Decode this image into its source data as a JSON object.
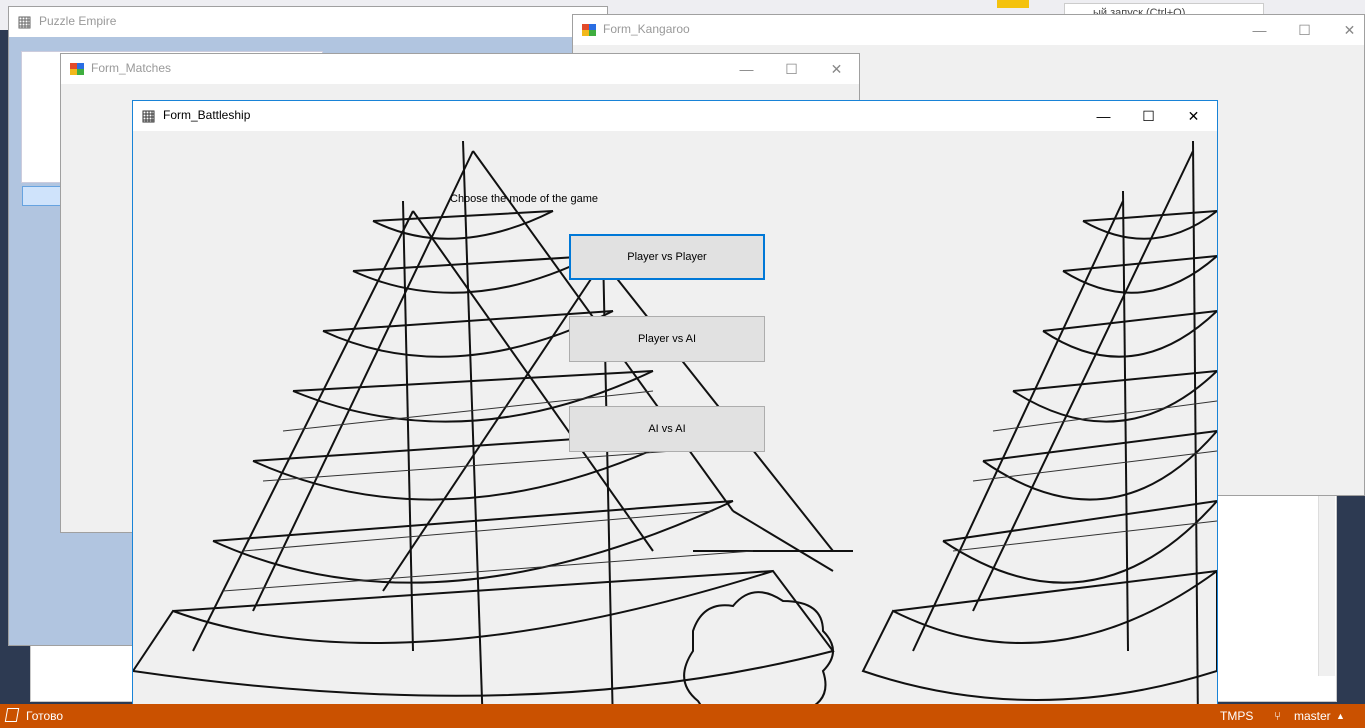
{
  "vs": {
    "quick_launch": "ый запуск (Ctrl+Q)",
    "status_ready": "Готово",
    "status_tmps": "TMPS",
    "branch": "master",
    "accent": "#ca5100"
  },
  "windows": {
    "puzzle_empire": {
      "title": "Puzzle Empire"
    },
    "kangaroo": {
      "title": "Form_Kangaroo"
    },
    "matches": {
      "title": "Form_Matches"
    },
    "battleship": {
      "title": "Form_Battleship",
      "prompt": "Choose the mode of the game",
      "buttons": {
        "pvp": "Player vs Player",
        "pvai": "Player vs AI",
        "aivai": "AI vs AI"
      }
    }
  },
  "captions": {
    "minimize": "—",
    "maximize": "☐",
    "close": "✕"
  }
}
